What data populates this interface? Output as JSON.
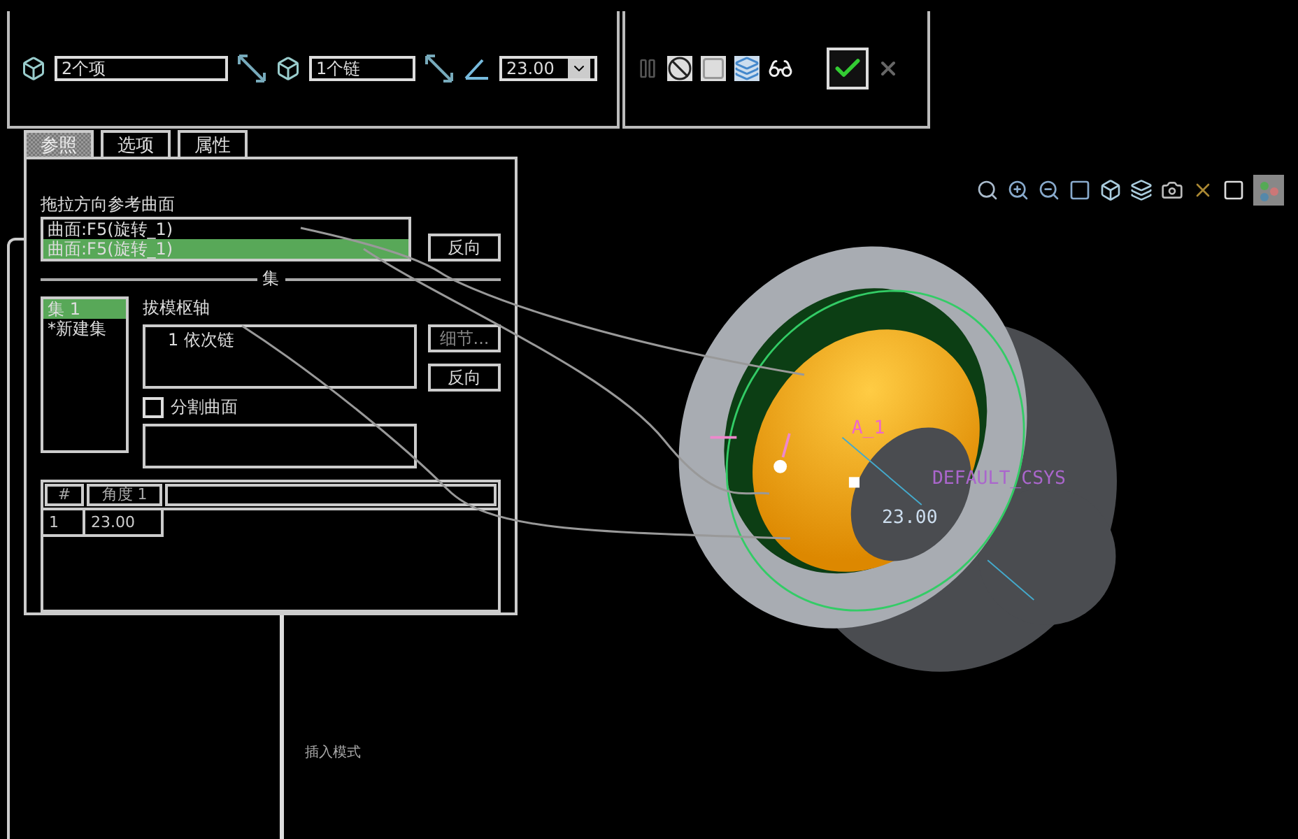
{
  "dashboard": {
    "surfaces_field": {
      "value": "2个项"
    },
    "chain_field": {
      "value": "1个链"
    },
    "angle_field": {
      "value": "23.00"
    }
  },
  "tabs": [
    {
      "label": "参照",
      "selected": true
    },
    {
      "label": "选项",
      "selected": false
    },
    {
      "label": "属性",
      "selected": false
    }
  ],
  "panel": {
    "reference_title": "拖拉方向参考曲面",
    "references": [
      {
        "label": "曲面:F5(旋转_1)",
        "selected": false
      },
      {
        "label": "曲面:F5(旋转_1)",
        "selected": true
      }
    ],
    "flip_button": "反向",
    "section_title": "集",
    "sets": [
      {
        "label": "集 1",
        "selected": true
      },
      {
        "label": "*新建集",
        "selected": false
      }
    ],
    "pivot_title": "拔模枢轴",
    "pivots": [
      "1 依次链"
    ],
    "details_button": {
      "label": "细节...",
      "disabled": true
    },
    "pivot_flip_button": "反向",
    "split": {
      "label": "分割曲面",
      "checked": false
    },
    "angle_table": {
      "columns": [
        "#",
        "角度 1"
      ],
      "rows": [
        [
          "1",
          "23.00"
        ]
      ]
    }
  },
  "model": {
    "axis_label": "A_1",
    "csys_label": "DEFAULT_CSYS",
    "dimension": "23.00"
  },
  "status": {
    "mode": "插入模式"
  }
}
